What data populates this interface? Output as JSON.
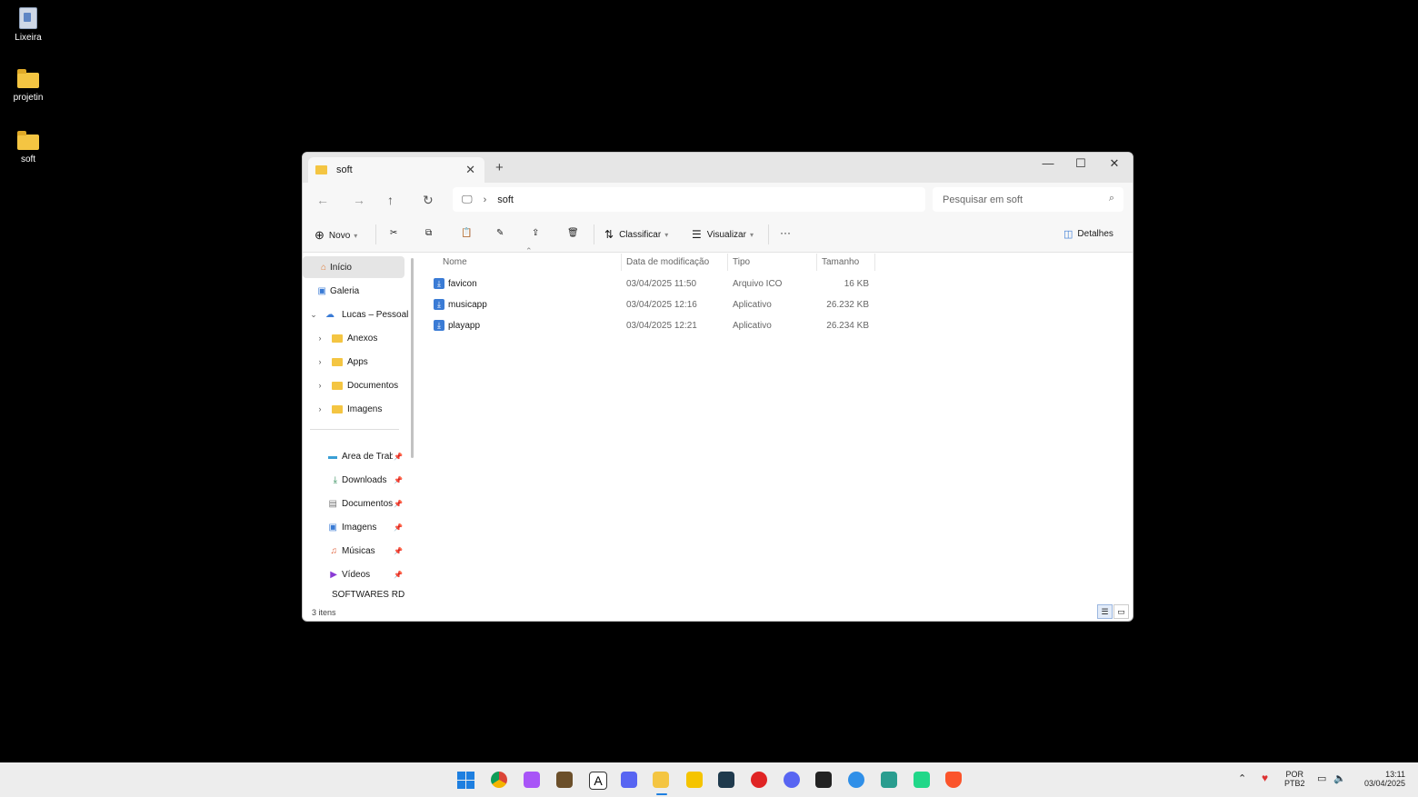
{
  "desktop": {
    "icons": [
      {
        "label": "Lixeira"
      },
      {
        "label": "projetin"
      },
      {
        "label": "soft"
      }
    ]
  },
  "window": {
    "tab_title": "soft",
    "new_tab": "+",
    "controls": {
      "minimize": "—",
      "maximize": "☐",
      "close": "✕"
    },
    "breadcrumb": [
      "soft"
    ],
    "search_placeholder": "Pesquisar em soft",
    "commands": {
      "new": "Novo",
      "sort": "Classificar",
      "view": "Visualizar",
      "more": "···",
      "details": "Detalhes"
    },
    "sidebar": {
      "home": "Início",
      "gallery": "Galeria",
      "onedrive": "Lucas – Pessoal",
      "onedrive_children": [
        "Anexos",
        "Apps",
        "Documentos",
        "Imagens"
      ],
      "quick": [
        "Área de Trabalho",
        "Downloads",
        "Documentos",
        "Imagens",
        "Músicas",
        "Vídeos",
        "SOFTWARES RD"
      ]
    },
    "columns": [
      "Nome",
      "Data de modificação",
      "Tipo",
      "Tamanho"
    ],
    "files": [
      {
        "name": "favicon",
        "date": "03/04/2025 11:50",
        "type": "Arquivo ICO",
        "size": "16 KB"
      },
      {
        "name": "musicapp",
        "date": "03/04/2025 12:16",
        "type": "Aplicativo",
        "size": "26.232 KB"
      },
      {
        "name": "playapp",
        "date": "03/04/2025 12:21",
        "type": "Aplicativo",
        "size": "26.234 KB"
      }
    ],
    "status": "3 itens"
  },
  "taskbar": {
    "lang": "POR",
    "layout": "PTB2",
    "time": "13:11",
    "date": "03/04/2025"
  },
  "colors": {
    "accent": "#3a7bd5",
    "folder": "#f4c542"
  }
}
